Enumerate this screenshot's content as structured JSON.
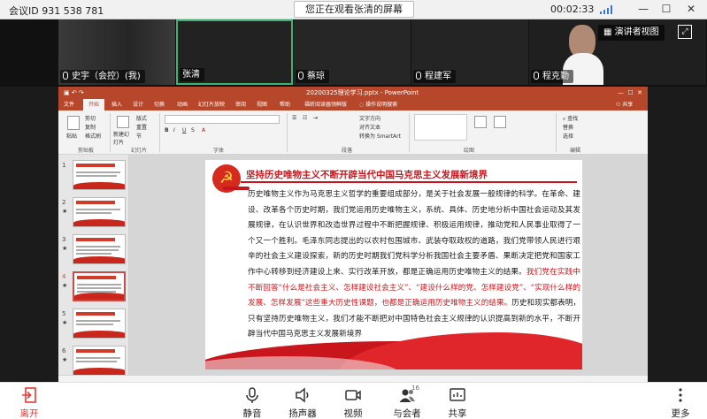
{
  "topbar": {
    "meeting_id": "会议ID 931 538 781",
    "share_banner": "您正在观看张清的屏幕",
    "timer": "00:02:33"
  },
  "participants": [
    {
      "name": "史宇（会控）(我)"
    },
    {
      "name": "张清"
    },
    {
      "name": "蔡琼"
    },
    {
      "name": "程建军"
    },
    {
      "name": "程克勤"
    }
  ],
  "speaker_view_label": "演讲者视图",
  "ppt": {
    "doc_title": "20200325理论学习.pptx - PowerPoint",
    "ribbon_tabs": [
      "文件",
      "开始",
      "插入",
      "设计",
      "切换",
      "动画",
      "幻灯片放映",
      "审阅",
      "视图",
      "帮助",
      "福昕阅读器领鲜版",
      "操作说明搜索",
      "共享"
    ],
    "active_tab": "开始",
    "ribbon_items": [
      "剪切",
      "复制",
      "格式刷",
      "粘贴",
      "新建幻灯片",
      "版式",
      "重置",
      "节",
      "文字方向",
      "对齐文本",
      "转换为 SmartArt",
      "查找",
      "替换",
      "选择"
    ],
    "ribbon_groups": [
      "剪贴板",
      "幻灯片",
      "字体",
      "段落",
      "绘图",
      "编辑"
    ],
    "thumbnails": [
      "1",
      "2",
      "3",
      "4",
      "5",
      "6"
    ],
    "selected_slide": "4"
  },
  "slide": {
    "title": "坚持历史唯物主义不断开辟当代中国马克思主义发展新境界",
    "body_a": "历史唯物主义作为马克思主义哲学的重要组成部分，是关于社会发展一般规律的科学。在革命、建设、改革各个历史时期，我们党运用历史唯物主义，系统、具体、历史地分析中国社会运动及其发展规律，在认识世界和改造世界过程中不断把握规律、积极运用规律，推动党和人民事业取得了一个又一个胜利。毛泽东同志提出的以农村包围城市、武装夺取政权的道路，我们党带领人民进行艰辛的社会主义建设探索，新的历史时期我们党科学分析我国社会主要矛盾、果断决定把党和国家工作中心转移到经济建设上来、实行改革开放，都是正确运用历史唯物主义的结果。",
    "body_highlight": "我们党在实践中不断回答“什么是社会主义、怎样建设社会主义”、“建设什么样的党、怎样建设党”、“实现什么样的发展、怎样发展”这些重大历史性课题，也都是正确运用历史唯物主义的结果。",
    "body_b": "历史和现实都表明，只有坚持历史唯物主义，我们才能不断把对中国特色社会主义规律的认识提高到新的水平，不断开辟当代中国马克思主义发展新境界"
  },
  "toolbar": {
    "leave": "离开",
    "mute": "静音",
    "speaker": "扬声器",
    "video": "视频",
    "participants": "与会者",
    "participant_count": "16",
    "share": "共享",
    "more": "更多"
  },
  "colors": {
    "ppt_red": "#b7472a",
    "slide_red": "#c8161d",
    "leave_red": "#e53935"
  }
}
